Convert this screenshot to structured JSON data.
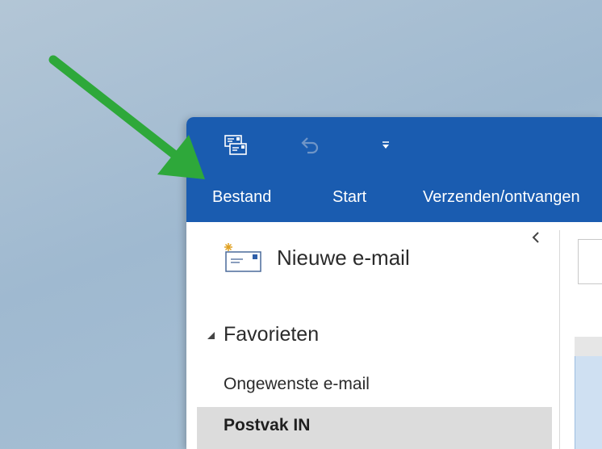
{
  "app": {
    "ribbon_tabs": [
      "Bestand",
      "Start",
      "Verzenden/ontvangen"
    ]
  },
  "quick_access": {
    "icons": [
      "send-receive-icon",
      "undo-icon",
      "customize-quick-access-icon"
    ]
  },
  "navigation": {
    "new_mail_label": "Nieuwe e-mail",
    "favorites_label": "Favorieten",
    "folders": [
      "Ongewenste e-mail",
      "Postvak IN"
    ],
    "selected_folder": "Postvak IN"
  },
  "colors": {
    "ribbon": "#1a5cb0",
    "annotation_arrow": "#2ea83a",
    "selected_row": "#dcdcdc"
  }
}
